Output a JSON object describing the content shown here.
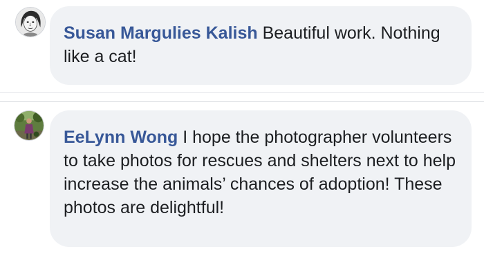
{
  "comments": [
    {
      "author": "Susan Margulies Kalish",
      "text": "Beautiful work. Nothing like a cat!",
      "avatar_icon": "sketch-face-avatar"
    },
    {
      "author": "EeLynn Wong",
      "text": "I hope the photographer volunteers to take photos for rescues and shelters next to help increase the animals’ chances of adoption! These photos are delightful!",
      "avatar_icon": "outdoor-photo-avatar"
    }
  ],
  "colors": {
    "author": "#385898",
    "bubble": "#f0f2f5",
    "text": "#1c1e21"
  }
}
